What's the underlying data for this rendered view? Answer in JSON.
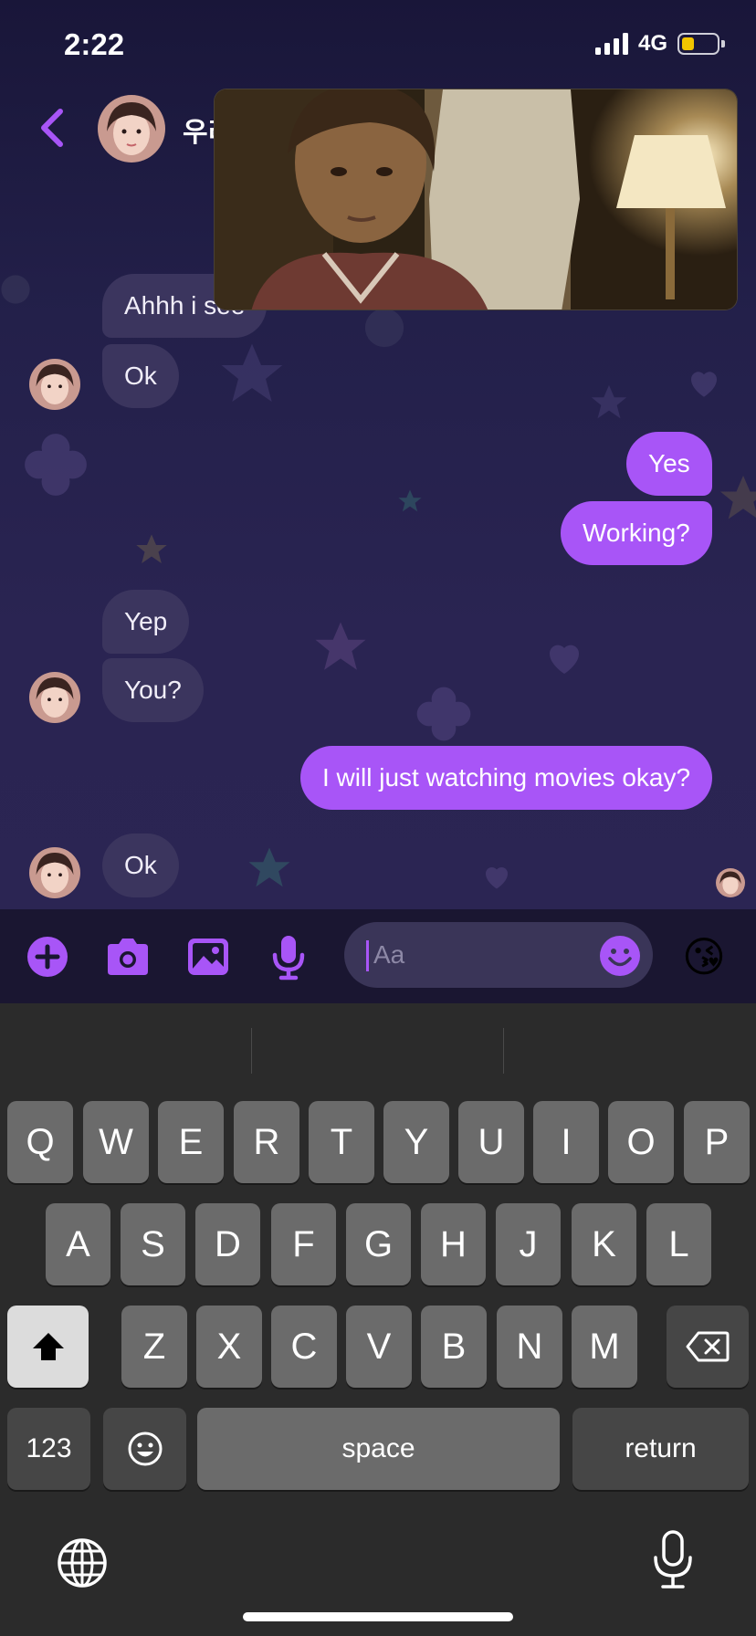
{
  "status": {
    "time": "2:22",
    "network": "4G",
    "battery_level": 0.35,
    "battery_color": "#f2c500"
  },
  "header": {
    "contact_name": "우리"
  },
  "theme": {
    "accent": "#a855f7",
    "incoming_bubble": "#3b355e",
    "background": "#1e1b3a"
  },
  "messages": [
    {
      "text": "Ahhh i see",
      "direction": "incoming"
    },
    {
      "text": "Ok",
      "direction": "incoming"
    },
    {
      "text": "Yes",
      "direction": "outgoing"
    },
    {
      "text": "Working?",
      "direction": "outgoing"
    },
    {
      "text": "Yep",
      "direction": "incoming"
    },
    {
      "text": "You?",
      "direction": "incoming"
    },
    {
      "text": "I will just watching movies okay?",
      "direction": "outgoing"
    },
    {
      "text": "Ok",
      "direction": "incoming"
    }
  ],
  "composer": {
    "placeholder": "Aa",
    "icons": [
      "plus-circle-icon",
      "camera-icon",
      "image-icon",
      "microphone-icon",
      "smile-icon"
    ],
    "quick_reaction": "😘"
  },
  "keyboard": {
    "row1": [
      "Q",
      "W",
      "E",
      "R",
      "T",
      "Y",
      "U",
      "I",
      "O",
      "P"
    ],
    "row2": [
      "A",
      "S",
      "D",
      "F",
      "G",
      "H",
      "J",
      "K",
      "L"
    ],
    "row3": [
      "Z",
      "X",
      "C",
      "V",
      "B",
      "N",
      "M"
    ],
    "numbers_key": "123",
    "space_key": "space",
    "return_key": "return"
  }
}
